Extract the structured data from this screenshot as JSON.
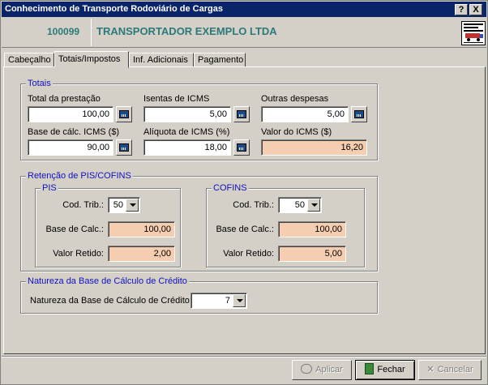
{
  "window": {
    "title": "Conhecimento de Transporte Rodoviário de Cargas",
    "help_label": "?",
    "close_label": "X"
  },
  "header": {
    "code": "100099",
    "company": "TRANSPORTADOR EXEMPLO LTDA",
    "logo_icon": "truck-document-icon"
  },
  "tabs": [
    {
      "label": "Cabeçalho",
      "active": false
    },
    {
      "label": "Totais/Impostos",
      "active": true
    },
    {
      "label": "Inf. Adicionais",
      "active": false
    },
    {
      "label": "Pagamento",
      "active": false
    }
  ],
  "totais": {
    "legend": "Totais",
    "total_prestacao_label": "Total da prestação",
    "total_prestacao_value": "100,00",
    "isentas_label": "Isentas de ICMS",
    "isentas_value": "5,00",
    "outras_label": "Outras despesas",
    "outras_value": "5,00",
    "base_calc_label": "Base de cálc. ICMS ($)",
    "base_calc_value": "90,00",
    "aliquota_label": "Alíquota de ICMS (%)",
    "aliquota_value": "18,00",
    "valor_icms_label": "Valor do ICMS ($)",
    "valor_icms_value": "16,20"
  },
  "retencao": {
    "legend": "Retenção de PIS/COFINS",
    "pis": {
      "legend": "PIS",
      "cod_trib_label": "Cod. Trib.:",
      "cod_trib_value": "50",
      "base_label": "Base de Calc.:",
      "base_value": "100,00",
      "retido_label": "Valor Retido:",
      "retido_value": "2,00"
    },
    "cofins": {
      "legend": "COFINS",
      "cod_trib_label": "Cod. Trib.:",
      "cod_trib_value": "50",
      "base_label": "Base de Calc.:",
      "base_value": "100,00",
      "retido_label": "Valor Retido:",
      "retido_value": "5,00"
    }
  },
  "natureza": {
    "legend": "Natureza da Base de Cálculo de Crédito",
    "label": "Natureza da Base de Cálculo de Crédito:",
    "value": "7"
  },
  "buttons": {
    "aplicar": "Aplicar",
    "fechar": "Fechar",
    "cancelar": "Cancelar"
  },
  "colors": {
    "title_bar": "#0a246a",
    "header_text": "#2a7a7a",
    "legend_text": "#1010c0",
    "readonly_field": "#f5cdb0"
  }
}
